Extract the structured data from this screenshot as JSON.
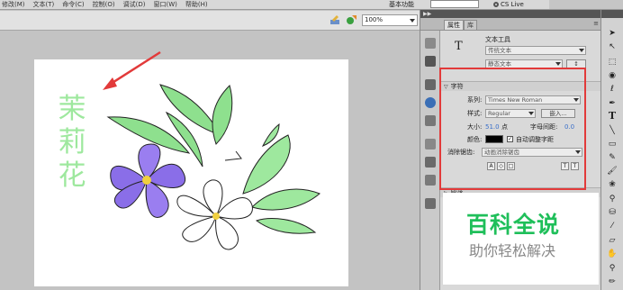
{
  "menubar": {
    "items": [
      "修改(M)",
      "文本(T)",
      "命令(C)",
      "控制(O)",
      "调试(D)",
      "窗口(W)",
      "帮助(H)"
    ],
    "workspace": "基本功能",
    "cs_live": "CS Live"
  },
  "editbar": {
    "zoom_value": "100%"
  },
  "stage": {
    "title_chars": [
      "茉",
      "莉",
      "花"
    ]
  },
  "properties": {
    "tabs": [
      "属性",
      "库"
    ],
    "tool_name": "文本工具",
    "text_type": "传统文本",
    "text_subtype": "静态文本",
    "section_character": "字符",
    "family_label": "系列:",
    "family_value": "Times New Roman",
    "style_label": "样式:",
    "style_value": "Regular",
    "embed_label": "嵌入...",
    "size_label": "大小:",
    "size_value": "51.0",
    "size_unit": "点",
    "spacing_label": "字母间距:",
    "spacing_value": "0.0",
    "color_label": "颜色:",
    "color_swatch": "#000000",
    "auto_kern_label": "自动调整字距",
    "aa_label": "消除锯齿:",
    "aa_value": "动画消除锯齿",
    "section_paragraph": "段落"
  },
  "watermark": {
    "line1": "百科全说",
    "line2": "助你轻松解决"
  },
  "colors": {
    "accent_red": "#e23a3a",
    "title_green": "#9ee89e",
    "watermark_green": "#1fbf5a",
    "link_blue": "#3a6fc9"
  },
  "tool_icons": [
    "selection-icon",
    "subselection-icon",
    "free-transform-icon",
    "3d-rotation-icon",
    "lasso-icon",
    "pen-icon",
    "text-tool-icon",
    "line-icon",
    "rectangle-icon",
    "pencil-icon",
    "brush-icon",
    "deco-icon",
    "bone-icon",
    "paint-bucket-icon",
    "eyedropper-icon",
    "eraser-icon",
    "hand-icon",
    "zoom-icon"
  ]
}
